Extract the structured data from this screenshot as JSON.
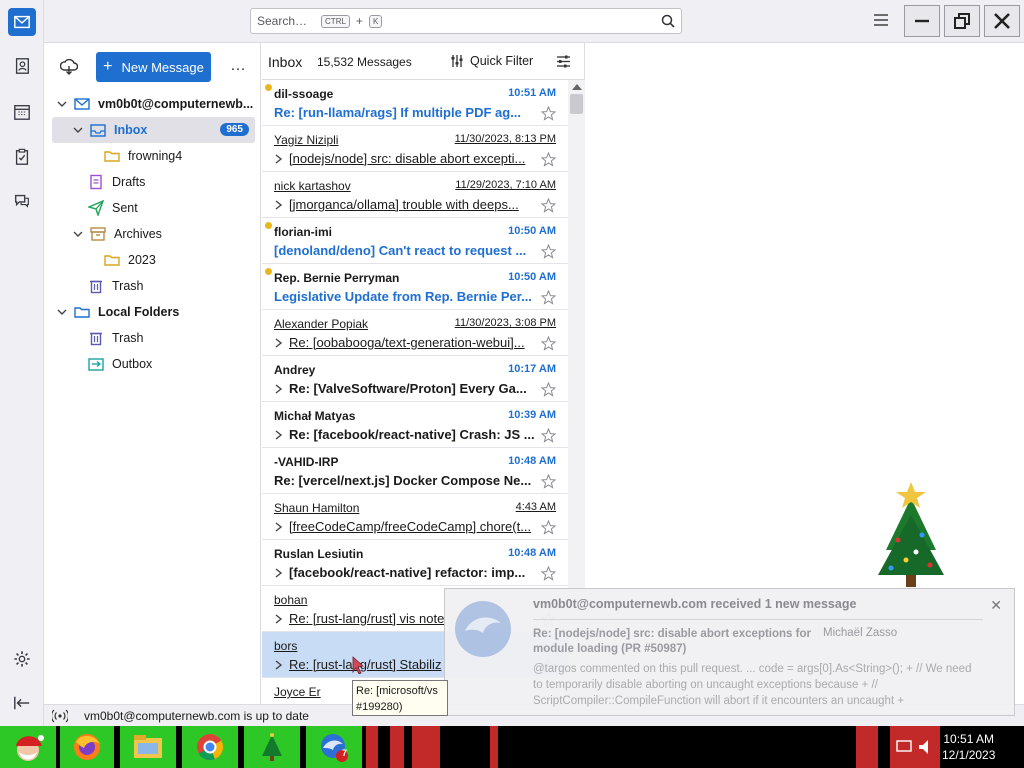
{
  "app": {
    "search_placeholder": "Search…",
    "search_shortcut_mod": "CTRL",
    "search_shortcut_plus": "+",
    "search_shortcut_key": "K"
  },
  "folder_pane": {
    "new_message_label": "New Message",
    "more_label": "…",
    "account": "vm0b0t@computernewb...",
    "folders": [
      {
        "label": "Inbox",
        "badge": "965"
      },
      {
        "label": "frowning4"
      },
      {
        "label": "Drafts"
      },
      {
        "label": "Sent"
      },
      {
        "label": "Archives"
      },
      {
        "label": "2023"
      },
      {
        "label": "Trash"
      },
      {
        "label": "Local Folders"
      },
      {
        "label": "Trash"
      },
      {
        "label": "Outbox"
      }
    ]
  },
  "message_list": {
    "title": "Inbox",
    "count": "15,532 Messages",
    "quick_filter_label": "Quick Filter",
    "messages": [
      {
        "sender": "dil-ssoage",
        "date": "10:51 AM",
        "subject": "Re: [run-llama/rags] If multiple PDF ag...",
        "state": "unread-blue"
      },
      {
        "sender": "Yagiz Nizipli",
        "date": "11/30/2023, 8:13 PM",
        "subject": "[nodejs/node] src: disable abort excepti...",
        "state": "read"
      },
      {
        "sender": "nick kartashov",
        "date": "11/29/2023, 7:10 AM",
        "subject": "[jmorganca/ollama] trouble with deeps...",
        "state": "read"
      },
      {
        "sender": "florian-imi",
        "date": "10:50 AM",
        "subject": "[denoland/deno] Can't react to request ...",
        "state": "unread-blue"
      },
      {
        "sender": "Rep. Bernie Perryman",
        "date": "10:50 AM",
        "subject": "Legislative Update from Rep. Bernie Per...",
        "state": "unread-blue"
      },
      {
        "sender": "Alexander Popiak",
        "date": "11/30/2023, 3:08 PM",
        "subject": "Re: [oobabooga/text-generation-webui]...",
        "state": "read"
      },
      {
        "sender": "Andrey",
        "date": "10:17 AM",
        "subject": "Re: [ValveSoftware/Proton] Every Ga...",
        "state": "unread-dark"
      },
      {
        "sender": "Michał Matyas",
        "date": "10:39 AM",
        "subject": "Re: [facebook/react-native] Crash: JS ...",
        "state": "unread-dark"
      },
      {
        "sender": "-VAHID-IRP",
        "date": "10:48 AM",
        "subject": "Re: [vercel/next.js] Docker Compose Ne...",
        "state": "unread-plain"
      },
      {
        "sender": "Shaun Hamilton",
        "date": "4:43 AM",
        "subject": "[freeCodeCamp/freeCodeCamp] chore(t...",
        "state": "read"
      },
      {
        "sender": "Ruslan Lesiutin",
        "date": "10:48 AM",
        "subject": "[facebook/react-native] refactor: imp...",
        "state": "unread-dark"
      },
      {
        "sender": "bohan",
        "date": "",
        "subject": "Re: [rust-lang/rust] vis note",
        "state": "read"
      },
      {
        "sender": "bors",
        "date": "",
        "subject": "Re: [rust-lang/rust] Stabiliz",
        "state": "read-selected"
      },
      {
        "sender": "Joyce Er",
        "date": "",
        "subject": "",
        "state": "read"
      }
    ]
  },
  "tooltip": {
    "line1": "Re: [microsoft/vs",
    "line2": "#199280)"
  },
  "status": {
    "text": "vm0b0t@computernewb.com is up to date"
  },
  "notification": {
    "title": "vm0b0t@computernewb.com received 1 new message",
    "subject": "Re: [nodejs/node] src: disable abort exceptions for module loading (PR #50987)",
    "from": "Michaël Zasso",
    "body": "@targos commented on this pull request. ... code = args[0].As<String>(); + // We need to temporarily disable aborting on uncaught exceptions because + // ScriptCompiler::CompileFunction will abort if it encounters an uncaught +",
    "close_label": "✕"
  },
  "taskbar": {
    "time": "10:51 AM",
    "date": "12/1/2023",
    "thunderbird_badge": "7"
  },
  "colors": {
    "accent": "#1f6fd1",
    "unread_dot": "#e7b71e",
    "selected_row": "#c9dcf5"
  }
}
